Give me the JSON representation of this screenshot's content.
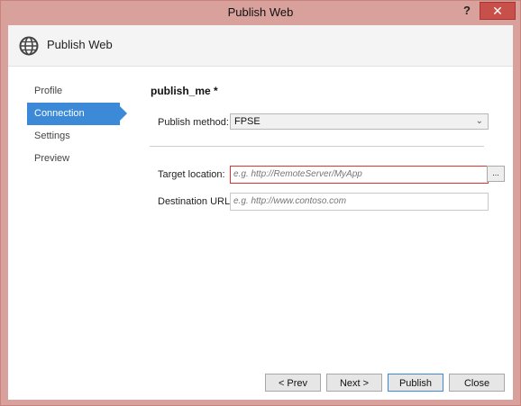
{
  "window": {
    "title": "Publish Web",
    "help_label": "?",
    "close_label": "✕"
  },
  "header": {
    "title": "Publish Web",
    "icon": "globe-icon"
  },
  "sidebar": {
    "items": [
      {
        "label": "Profile",
        "active": false
      },
      {
        "label": "Connection",
        "active": true
      },
      {
        "label": "Settings",
        "active": false
      },
      {
        "label": "Preview",
        "active": false
      }
    ]
  },
  "main": {
    "profile_name": "publish_me *",
    "publish_method_label": "Publish method:",
    "publish_method_value": "FPSE",
    "target_location_label": "Target location:",
    "target_location_placeholder": "e.g. http://RemoteServer/MyApp",
    "browse_label": "...",
    "destination_url_label": "Destination URL:",
    "destination_url_placeholder": "e.g. http://www.contoso.com"
  },
  "buttons": {
    "prev": "< Prev",
    "next": "Next >",
    "publish": "Publish",
    "close": "Close"
  },
  "colors": {
    "accent": "#3c8ad7",
    "window_frame": "#d8a19b",
    "error_border": "#dd3333"
  }
}
